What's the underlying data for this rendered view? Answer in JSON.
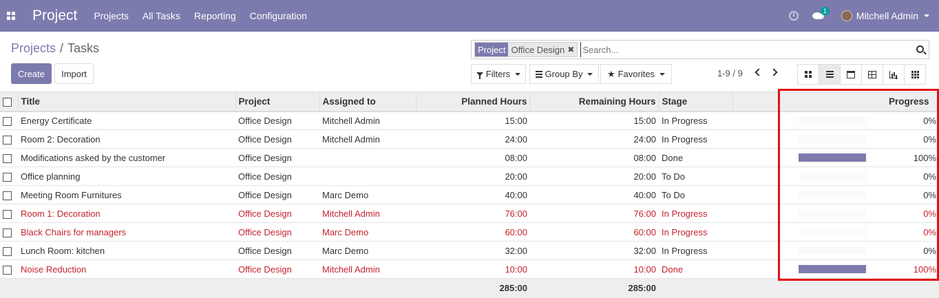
{
  "navbar": {
    "app_name": "Project",
    "menu": [
      "Projects",
      "All Tasks",
      "Reporting",
      "Configuration"
    ],
    "chat_badge": "1",
    "user_name": "Mitchell Admin"
  },
  "breadcrumb": {
    "parent": "Projects",
    "separator": "/",
    "current": "Tasks"
  },
  "buttons": {
    "create": "Create",
    "import": "Import"
  },
  "search": {
    "facet_key": "Project",
    "facet_value": "Office Design",
    "facet_remove": "✖",
    "placeholder": "Search..."
  },
  "filters": {
    "filters": "Filters",
    "group_by": "Group By",
    "favorites": "Favorites"
  },
  "pager": {
    "range": "1-9 / 9"
  },
  "views": [
    "kanban",
    "list",
    "calendar",
    "pivot",
    "graph",
    "grid"
  ],
  "active_view": "list",
  "colors": {
    "brand": "#7c7bad",
    "overdue": "#c4232c",
    "highlight": "#e1101a"
  },
  "table": {
    "columns": [
      "Title",
      "Project",
      "Assigned to",
      "Planned Hours",
      "Remaining Hours",
      "Stage",
      "Progress"
    ],
    "rows": [
      {
        "title": "Energy Certificate",
        "project": "Office Design",
        "assigned": "Mitchell Admin",
        "planned": "15:00",
        "remaining": "15:00",
        "stage": "In Progress",
        "progress_label": "0%",
        "progress": 0,
        "overdue": false
      },
      {
        "title": "Room 2: Decoration",
        "project": "Office Design",
        "assigned": "Mitchell Admin",
        "planned": "24:00",
        "remaining": "24:00",
        "stage": "In Progress",
        "progress_label": "0%",
        "progress": 0,
        "overdue": false
      },
      {
        "title": "Modifications asked by the customer",
        "project": "Office Design",
        "assigned": "",
        "planned": "08:00",
        "remaining": "08:00",
        "stage": "Done",
        "progress_label": "100%",
        "progress": 100,
        "overdue": false
      },
      {
        "title": "Office planning",
        "project": "Office Design",
        "assigned": "",
        "planned": "20:00",
        "remaining": "20:00",
        "stage": "To Do",
        "progress_label": "0%",
        "progress": 0,
        "overdue": false
      },
      {
        "title": "Meeting Room Furnitures",
        "project": "Office Design",
        "assigned": "Marc Demo",
        "planned": "40:00",
        "remaining": "40:00",
        "stage": "To Do",
        "progress_label": "0%",
        "progress": 0,
        "overdue": false
      },
      {
        "title": "Room 1: Decoration",
        "project": "Office Design",
        "assigned": "Mitchell Admin",
        "planned": "76:00",
        "remaining": "76:00",
        "stage": "In Progress",
        "progress_label": "0%",
        "progress": 0,
        "overdue": true
      },
      {
        "title": "Black Chairs for managers",
        "project": "Office Design",
        "assigned": "Marc Demo",
        "planned": "60:00",
        "remaining": "60:00",
        "stage": "In Progress",
        "progress_label": "0%",
        "progress": 0,
        "overdue": true
      },
      {
        "title": "Lunch Room: kitchen",
        "project": "Office Design",
        "assigned": "Marc Demo",
        "planned": "32:00",
        "remaining": "32:00",
        "stage": "In Progress",
        "progress_label": "0%",
        "progress": 0,
        "overdue": false
      },
      {
        "title": "Noise Reduction",
        "project": "Office Design",
        "assigned": "Mitchell Admin",
        "planned": "10:00",
        "remaining": "10:00",
        "stage": "Done",
        "progress_label": "100%",
        "progress": 100,
        "overdue": true
      }
    ],
    "totals": {
      "planned": "285:00",
      "remaining": "285:00"
    }
  }
}
